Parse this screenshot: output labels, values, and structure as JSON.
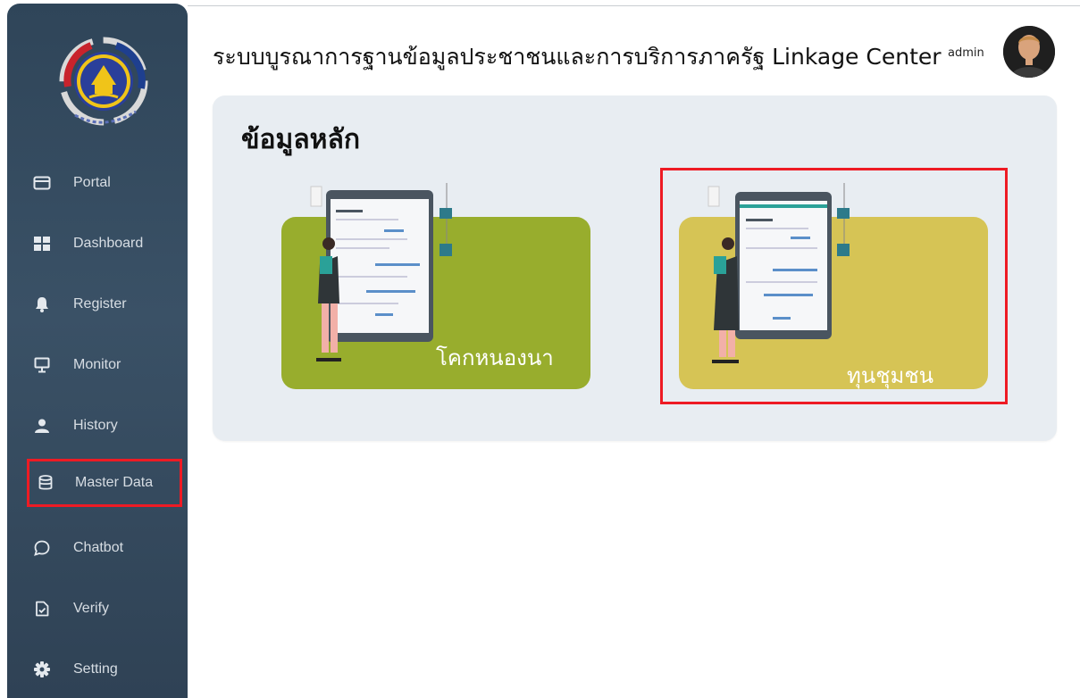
{
  "header": {
    "title": "ระบบบูรณาการฐานข้อมูลประชาชนและการบริการภาครัฐ Linkage Center",
    "user_name": "admin"
  },
  "sidebar": {
    "logo_icon": "department-seal-icon",
    "items": [
      {
        "label": "Portal",
        "icon": "portal-card-icon"
      },
      {
        "label": "Dashboard",
        "icon": "dashboard-grid-icon"
      },
      {
        "label": "Register",
        "icon": "bell-icon"
      },
      {
        "label": "Monitor",
        "icon": "monitor-icon"
      },
      {
        "label": "History",
        "icon": "user-icon"
      },
      {
        "label": "Master Data",
        "icon": "database-icon",
        "selected": true
      },
      {
        "label": "Chatbot",
        "icon": "chat-bubble-icon"
      },
      {
        "label": "Verify",
        "icon": "file-check-icon"
      },
      {
        "label": "Setting",
        "icon": "gear-icon"
      }
    ]
  },
  "main": {
    "section_title": "ข้อมูลหลัก",
    "cards": [
      {
        "label": "โคกหนองนา",
        "color": "#98ad2d",
        "illustration": "woman-with-tablet-illustration"
      },
      {
        "label": "ทุนชุมชน",
        "color": "#d6c455",
        "illustration": "woman-with-tablet-illustration",
        "highlighted": true
      }
    ]
  },
  "colors": {
    "sidebar_bg": "#34495e",
    "highlight": "#ee1b24",
    "panel_bg": "#e8edf2"
  }
}
